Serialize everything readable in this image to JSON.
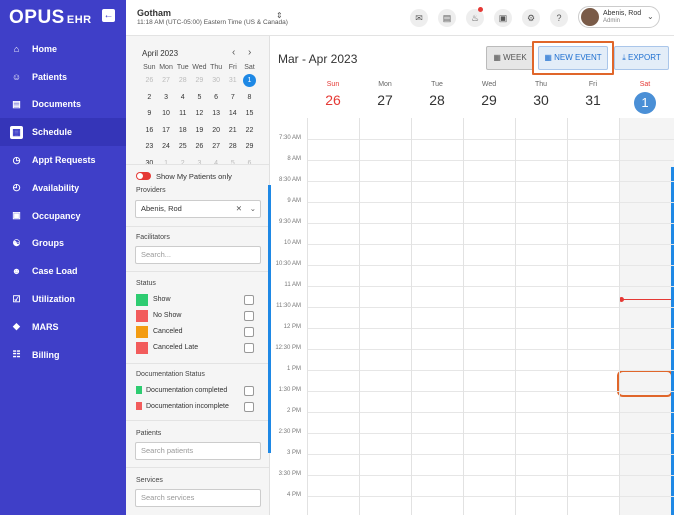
{
  "brand": {
    "name": "OPUS",
    "suffix": "EHR"
  },
  "sidebar": {
    "items": [
      {
        "label": "Home",
        "icon": "home-icon"
      },
      {
        "label": "Patients",
        "icon": "patients-icon"
      },
      {
        "label": "Documents",
        "icon": "documents-icon"
      },
      {
        "label": "Schedule",
        "icon": "schedule-icon",
        "active": true
      },
      {
        "label": "Appt Requests",
        "icon": "appt-requests-icon"
      },
      {
        "label": "Availability",
        "icon": "availability-icon"
      },
      {
        "label": "Occupancy",
        "icon": "occupancy-icon"
      },
      {
        "label": "Groups",
        "icon": "groups-icon"
      },
      {
        "label": "Case Load",
        "icon": "case-load-icon"
      },
      {
        "label": "Utilization",
        "icon": "utilization-icon"
      },
      {
        "label": "MARS",
        "icon": "mars-icon"
      },
      {
        "label": "Billing",
        "icon": "billing-icon"
      }
    ]
  },
  "topbar": {
    "location": "Gotham",
    "timezone": "11:18 AM (UTC-05:00) Eastern Time (US & Canada)",
    "user_name": "Abenis, Rod",
    "user_role": "Admin"
  },
  "minical": {
    "title": "April 2023",
    "dow": [
      "Sun",
      "Mon",
      "Tue",
      "Wed",
      "Thu",
      "Fri",
      "Sat"
    ],
    "weeks": [
      [
        "26",
        "27",
        "28",
        "29",
        "30",
        "31",
        "1"
      ],
      [
        "2",
        "3",
        "4",
        "5",
        "6",
        "7",
        "8"
      ],
      [
        "9",
        "10",
        "11",
        "12",
        "13",
        "14",
        "15"
      ],
      [
        "16",
        "17",
        "18",
        "19",
        "20",
        "21",
        "22"
      ],
      [
        "23",
        "24",
        "25",
        "26",
        "27",
        "28",
        "29"
      ],
      [
        "30",
        "1",
        "2",
        "3",
        "4",
        "5",
        "6"
      ]
    ]
  },
  "filters": {
    "show_my_patients": "Show My Patients only",
    "providers_label": "Providers",
    "provider_value": "Abenis, Rod",
    "facilitators_label": "Facilitators",
    "facilitators_placeholder": "Search...",
    "status_label": "Status",
    "statuses": [
      {
        "label": "Show",
        "color": "#2ecc71"
      },
      {
        "label": "No Show",
        "color": "#f25c5c"
      },
      {
        "label": "Canceled",
        "color": "#f39c12"
      },
      {
        "label": "Canceled Late",
        "color": "#f25c5c"
      }
    ],
    "doc_status_label": "Documentation Status",
    "doc_statuses": [
      {
        "label": "Documentation completed",
        "color": "#2ecc71"
      },
      {
        "label": "Documentation incomplete",
        "color": "#f25c5c"
      }
    ],
    "patients_label": "Patients",
    "patients_placeholder": "Search patients",
    "services_label": "Services",
    "services_placeholder": "Search services"
  },
  "calendar": {
    "range": "Mar - Apr 2023",
    "week_label": "WEEK",
    "new_event_label": "NEW EVENT",
    "export_label": "EXPORT",
    "days": [
      {
        "dow": "Sun",
        "num": "26"
      },
      {
        "dow": "Mon",
        "num": "27"
      },
      {
        "dow": "Tue",
        "num": "28"
      },
      {
        "dow": "Wed",
        "num": "29"
      },
      {
        "dow": "Thu",
        "num": "30"
      },
      {
        "dow": "Fri",
        "num": "31"
      },
      {
        "dow": "Sat",
        "num": "1"
      }
    ],
    "times": [
      "7:30 AM",
      "8 AM",
      "8:30 AM",
      "9 AM",
      "9:30 AM",
      "10 AM",
      "10:30 AM",
      "11 AM",
      "11:30 AM",
      "12 PM",
      "12:30 PM",
      "1 PM",
      "1:30 PM",
      "2 PM",
      "2:30 PM",
      "3 PM",
      "3:30 PM",
      "4 PM"
    ]
  },
  "colors": {
    "sidebar": "#3f3fc8",
    "accent": "#1e88e5",
    "highlight": "#e0662a",
    "now": "#e53935"
  }
}
